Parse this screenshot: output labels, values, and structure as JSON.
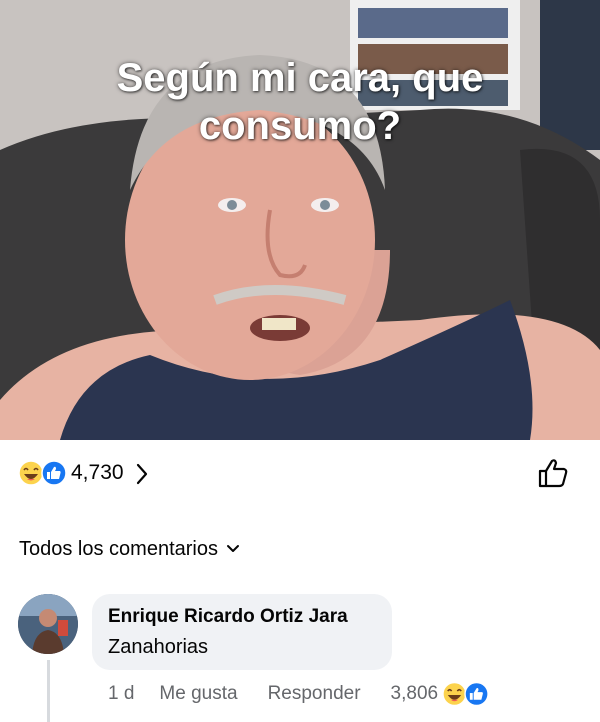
{
  "post": {
    "caption": "Según mi cara, que consumo?",
    "reaction_count": "4,730",
    "reaction_icons": [
      "haha-icon",
      "like-icon"
    ]
  },
  "comments_filter": {
    "label": "Todos los comentarios"
  },
  "comment": {
    "author": "Enrique Ricardo Ortiz Jara",
    "text": "Zanahorias",
    "time": "1 d",
    "like_label": "Me gusta",
    "reply_label": "Responder",
    "reaction_count": "3,806",
    "reaction_icons": [
      "haha-icon",
      "like-icon"
    ]
  },
  "colors": {
    "facebook_blue": "#1877f2",
    "haha_yellow": "#fcd34d",
    "secondary_text": "#65676b",
    "bubble_bg": "#f0f2f5"
  }
}
